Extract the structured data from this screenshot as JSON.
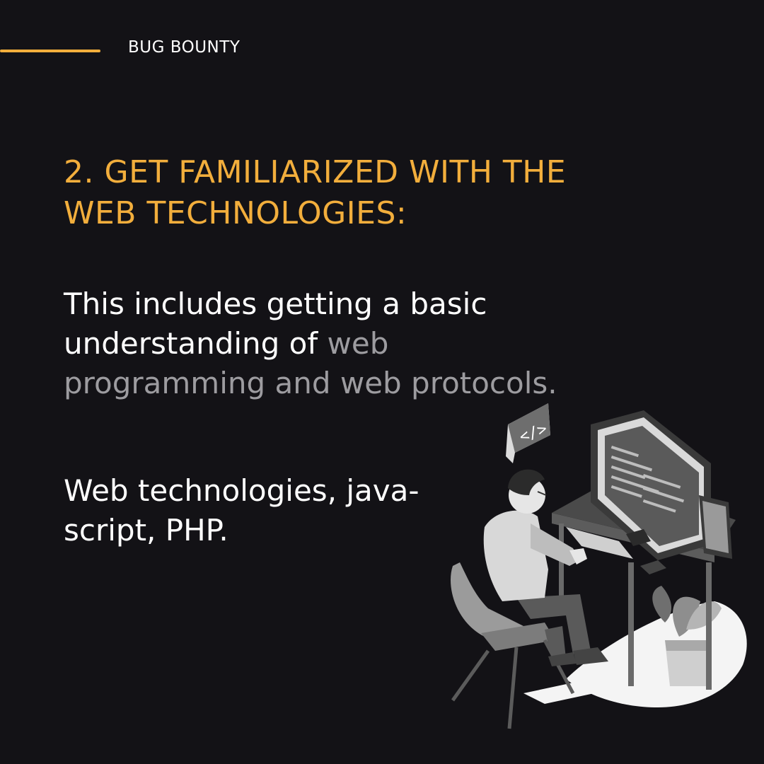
{
  "header": {
    "label": "BUG BOUNTY",
    "accent_color": "#f2ae3c"
  },
  "slide": {
    "title_line_1": "2. GET FAMILIARIZED WITH THE",
    "title_line_2": "WEB TECHNOLOGIES:",
    "paragraph_1": {
      "text_normal": "This includes getting a basic understanding of ",
      "text_muted": "web programming and web protocols."
    },
    "paragraph_2": {
      "line_1": "Web technologies, java-",
      "line_2": "script, PHP."
    }
  },
  "illustration": {
    "code_badge": "</>",
    "icon": "developer-at-desk-illustration"
  },
  "colors": {
    "background": "#131216",
    "accent": "#f2ae3c",
    "text": "#ffffff",
    "muted_text": "#9d9ca0"
  }
}
